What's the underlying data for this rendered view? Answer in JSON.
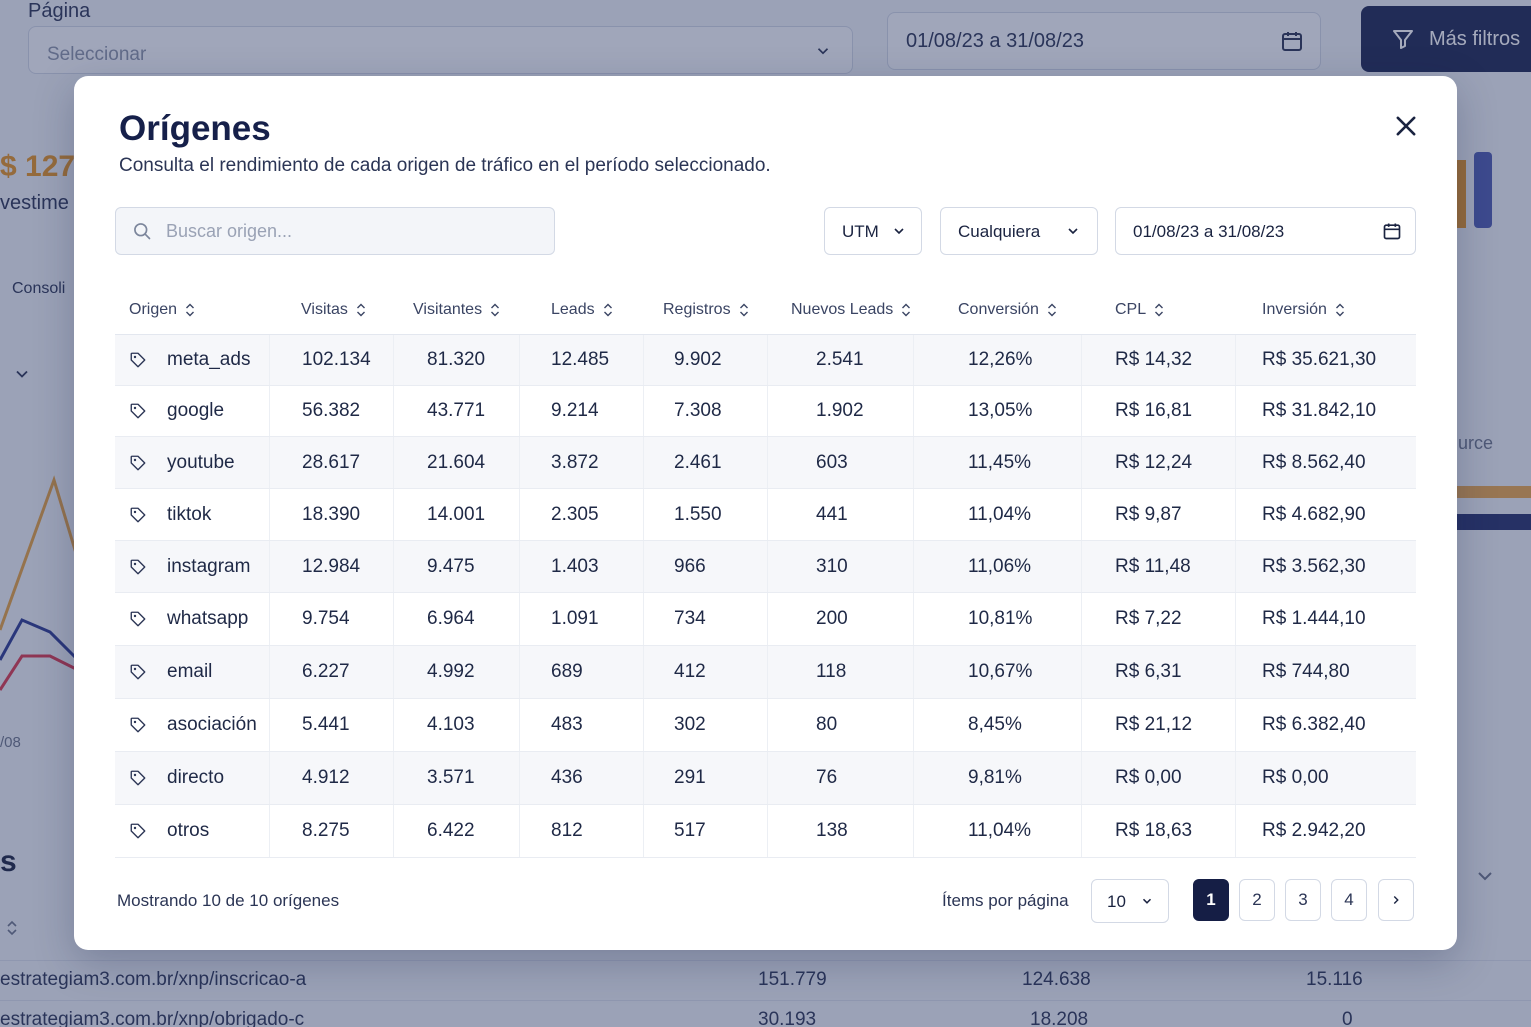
{
  "background": {
    "page_label": "Página",
    "page_select_placeholder": "Seleccionar",
    "date_range": "01/08/23 a 31/08/23",
    "more_filters_label": "Más filtros",
    "kpi_value": "$ 127.",
    "kpi_label": "vestime",
    "consolidated_label": "Consoli",
    "axis_tick": "/08",
    "section_title": "s",
    "source_label": "urce",
    "rows": [
      {
        "url": "estrategiam3.com.br/xnp/inscricao-a",
        "v1": "151.779",
        "v2": "124.638",
        "v3": "15.116"
      },
      {
        "url": "estrategiam3.com.br/xnp/obrigado-c",
        "v1": "30.193",
        "v2": "18.208",
        "v3": "0"
      }
    ]
  },
  "modal": {
    "title": "Orígenes",
    "subtitle": "Consulta el rendimiento de cada origen de tráfico en el período seleccionado.",
    "search_placeholder": "Buscar origen...",
    "filter_utm": "UTM",
    "filter_any": "Cualquiera",
    "date_range": "01/08/23 a 31/08/23",
    "columns": [
      "Origen",
      "Visitas",
      "Visitantes",
      "Leads",
      "Registros",
      "Nuevos Leads",
      "Conversión",
      "CPL",
      "Inversión"
    ],
    "rows": [
      [
        "meta_ads",
        "102.134",
        "81.320",
        "12.485",
        "9.902",
        "2.541",
        "12,26%",
        "R$ 14,32",
        "R$ 35.621,30"
      ],
      [
        "google",
        "56.382",
        "43.771",
        "9.214",
        "7.308",
        "1.902",
        "13,05%",
        "R$ 16,81",
        "R$ 31.842,10"
      ],
      [
        "youtube",
        "28.617",
        "21.604",
        "3.872",
        "2.461",
        "603",
        "11,45%",
        "R$ 12,24",
        "R$ 8.562,40"
      ],
      [
        "tiktok",
        "18.390",
        "14.001",
        "2.305",
        "1.550",
        "441",
        "11,04%",
        "R$ 9,87",
        "R$ 4.682,90"
      ],
      [
        "instagram",
        "12.984",
        "9.475",
        "1.403",
        "966",
        "310",
        "11,06%",
        "R$ 11,48",
        "R$ 3.562,30"
      ],
      [
        "whatsapp",
        "9.754",
        "6.964",
        "1.091",
        "734",
        "200",
        "10,81%",
        "R$ 7,22",
        "R$ 1.444,10"
      ],
      [
        "email",
        "6.227",
        "4.992",
        "689",
        "412",
        "118",
        "10,67%",
        "R$ 6,31",
        "R$ 744,80"
      ],
      [
        "asociación",
        "5.441",
        "4.103",
        "483",
        "302",
        "80",
        "8,45%",
        "R$ 21,12",
        "R$ 6.382,40"
      ],
      [
        "directo",
        "4.912",
        "3.571",
        "436",
        "291",
        "76",
        "9,81%",
        "R$ 0,00",
        "R$ 0,00"
      ],
      [
        "otros",
        "8.275",
        "6.422",
        "812",
        "517",
        "138",
        "11,04%",
        "R$ 18,63",
        "R$ 2.942,20"
      ]
    ],
    "showing_text": "Mostrando 10 de 10 orígenes",
    "items_per_page_label": "Ítems por página",
    "items_per_page_value": "10",
    "pages": [
      "1",
      "2",
      "3",
      "4"
    ],
    "current_page": "1",
    "icons": {
      "close": "close-icon",
      "search": "search-icon",
      "calendar": "calendar-icon",
      "tag": "tag-icon",
      "sort": "sort-icon",
      "next": "chevron-right-icon"
    }
  }
}
